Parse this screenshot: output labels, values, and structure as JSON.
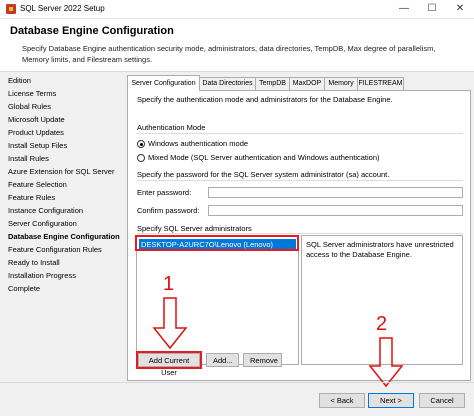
{
  "window": {
    "title": "SQL Server 2022 Setup"
  },
  "header": {
    "title": "Database Engine Configuration",
    "description": "Specify Database Engine authentication security mode, administrators, data directories, TempDB, Max degree of parallelism, Memory limits, and Filestream settings."
  },
  "sidebar": {
    "items": [
      {
        "label": "Edition"
      },
      {
        "label": "License Terms"
      },
      {
        "label": "Global Rules"
      },
      {
        "label": "Microsoft Update"
      },
      {
        "label": "Product Updates"
      },
      {
        "label": "Install Setup Files"
      },
      {
        "label": "Install Rules"
      },
      {
        "label": "Azure Extension for SQL Server"
      },
      {
        "label": "Feature Selection"
      },
      {
        "label": "Feature Rules"
      },
      {
        "label": "Instance Configuration"
      },
      {
        "label": "Server Configuration"
      },
      {
        "label": "Database Engine Configuration"
      },
      {
        "label": "Feature Configuration Rules"
      },
      {
        "label": "Ready to Install"
      },
      {
        "label": "Installation Progress"
      },
      {
        "label": "Complete"
      }
    ]
  },
  "tabs": [
    {
      "label": "Server Configuration"
    },
    {
      "label": "Data Directories"
    },
    {
      "label": "TempDB"
    },
    {
      "label": "MaxDOP"
    },
    {
      "label": "Memory"
    },
    {
      "label": "FILESTREAM"
    }
  ],
  "panel": {
    "intro": "Specify the authentication mode and administrators for the Database Engine.",
    "auth_mode_label": "Authentication Mode",
    "windows_auth": "Windows authentication mode",
    "mixed_mode": "Mixed Mode (SQL Server authentication and Windows authentication)",
    "sa_password_label": "Specify the password for the SQL Server system administrator (sa) account.",
    "enter_password_label": "Enter password:",
    "confirm_password_label": "Confirm password:",
    "enter_password_value": "",
    "confirm_password_value": "",
    "admins_label": "Specify SQL Server administrators",
    "admins": [
      "DESKTOP-A2URC7O\\Lenovo (Lenovo)"
    ],
    "admins_info": "SQL Server administrators have unrestricted access to the Database Engine.",
    "add_current_user": "Add Current User",
    "add": "Add...",
    "remove": "Remove"
  },
  "footer": {
    "back": "< Back",
    "next": "Next >",
    "cancel": "Cancel"
  },
  "annotations": {
    "one": "1",
    "two": "2"
  },
  "colors": {
    "selection": "#0078d7",
    "annotation_red": "#e51c23"
  }
}
